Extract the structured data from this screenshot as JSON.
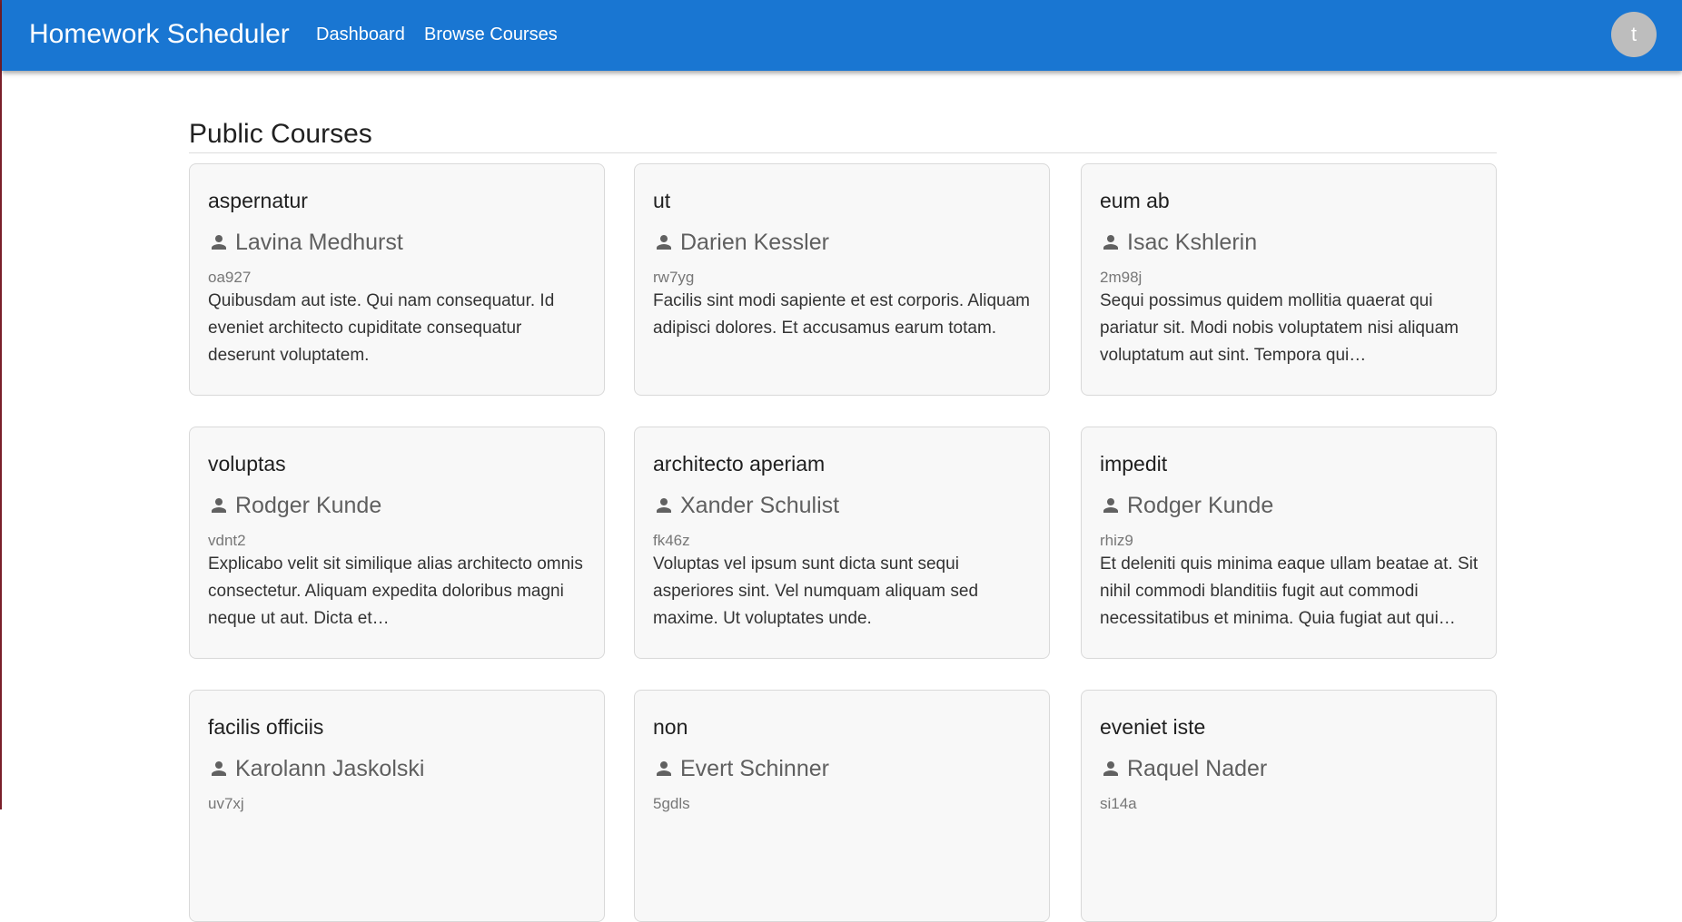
{
  "appbar": {
    "title": "Homework Scheduler",
    "nav": [
      {
        "label": "Dashboard"
      },
      {
        "label": "Browse Courses"
      }
    ],
    "avatar_initial": "t",
    "color": "#1976d2"
  },
  "page": {
    "title": "Public Courses"
  },
  "courses": [
    {
      "name": "aspernatur",
      "owner": "Lavina Medhurst",
      "code": "oa927",
      "description": "Quibusdam aut iste. Qui nam consequatur. Id eveniet architecto cupiditate consequatur deserunt voluptatem."
    },
    {
      "name": "ut",
      "owner": "Darien Kessler",
      "code": "rw7yg",
      "description": "Facilis sint modi sapiente et est corporis. Aliquam adipisci dolores. Et accusamus earum totam."
    },
    {
      "name": "eum ab",
      "owner": "Isac Kshlerin",
      "code": "2m98j",
      "description": "Sequi possimus quidem mollitia quaerat qui pariatur sit. Modi nobis voluptatem nisi aliquam voluptatum aut sint. Tempora qui…"
    },
    {
      "name": "voluptas",
      "owner": "Rodger Kunde",
      "code": "vdnt2",
      "description": "Explicabo velit sit similique alias architecto omnis consectetur. Aliquam expedita doloribus magni neque ut aut. Dicta et…"
    },
    {
      "name": "architecto aperiam",
      "owner": "Xander Schulist",
      "code": "fk46z",
      "description": "Voluptas vel ipsum sunt dicta sunt sequi asperiores sint. Vel numquam aliquam sed maxime. Ut voluptates unde."
    },
    {
      "name": "impedit",
      "owner": "Rodger Kunde",
      "code": "rhiz9",
      "description": "Et deleniti quis minima eaque ullam beatae at. Sit nihil commodi blanditiis fugit aut commodi necessitatibus et minima. Quia fugiat aut qui…"
    },
    {
      "name": "facilis officiis",
      "owner": "Karolann Jaskolski",
      "code": "uv7xj",
      "description": ""
    },
    {
      "name": "non",
      "owner": "Evert Schinner",
      "code": "5gdls",
      "description": ""
    },
    {
      "name": "eveniet iste",
      "owner": "Raquel Nader",
      "code": "si14a",
      "description": ""
    }
  ],
  "icons": {
    "owner_icon": "person-icon"
  }
}
